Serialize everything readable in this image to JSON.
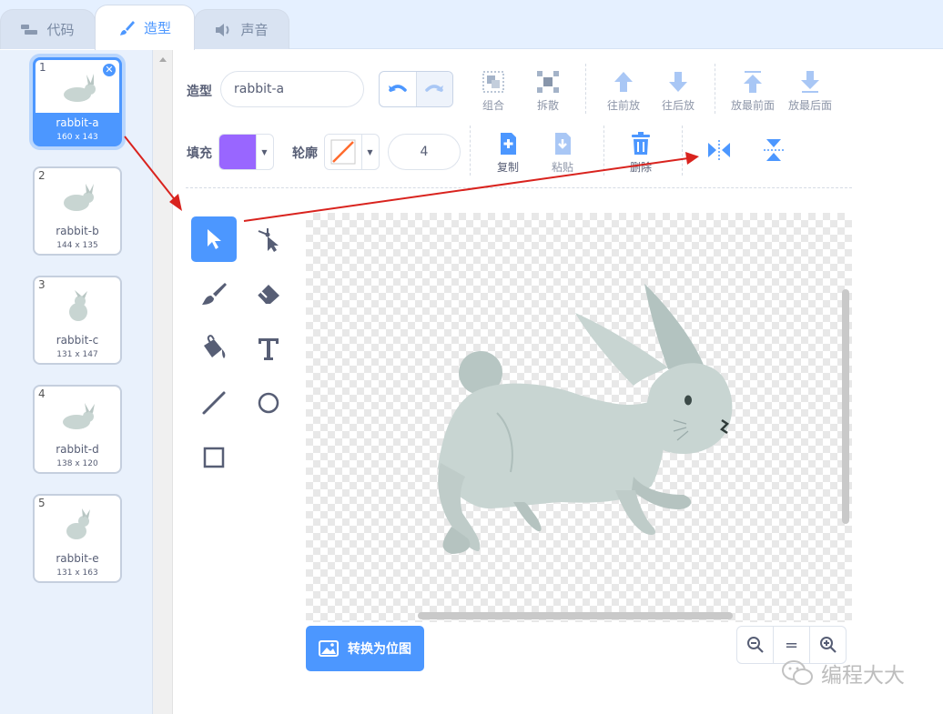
{
  "tabs": [
    {
      "label": "代码",
      "icon": "code-blocks-icon"
    },
    {
      "label": "造型",
      "icon": "brush-icon"
    },
    {
      "label": "声音",
      "icon": "speaker-icon"
    }
  ],
  "costumes": [
    {
      "num": "1",
      "name": "rabbit-a",
      "size": "160 x 143"
    },
    {
      "num": "2",
      "name": "rabbit-b",
      "size": "144 x 135"
    },
    {
      "num": "3",
      "name": "rabbit-c",
      "size": "131 x 147"
    },
    {
      "num": "4",
      "name": "rabbit-d",
      "size": "138 x 120"
    },
    {
      "num": "5",
      "name": "rabbit-e",
      "size": "131 x 163"
    }
  ],
  "toolbar": {
    "costume_label": "造型",
    "costume_name": "rabbit-a",
    "group": "组合",
    "ungroup": "拆散",
    "forward": "往前放",
    "backward": "往后放",
    "front": "放最前面",
    "back": "放最后面",
    "fill_label": "填充",
    "outline_label": "轮廓",
    "outline_width": "4",
    "copy": "复制",
    "paste": "粘贴",
    "delete": "删除"
  },
  "colors": {
    "accent": "#4c97ff",
    "fill": "#9966ff",
    "outline_slash": "#ff6b2e",
    "arrow": "#d9231e",
    "rabbit": "#c8d5d2"
  },
  "convert_label": "转换为位图",
  "zoom": {
    "out": "−",
    "reset": "=",
    "in": "+"
  },
  "watermark": "编程大大"
}
